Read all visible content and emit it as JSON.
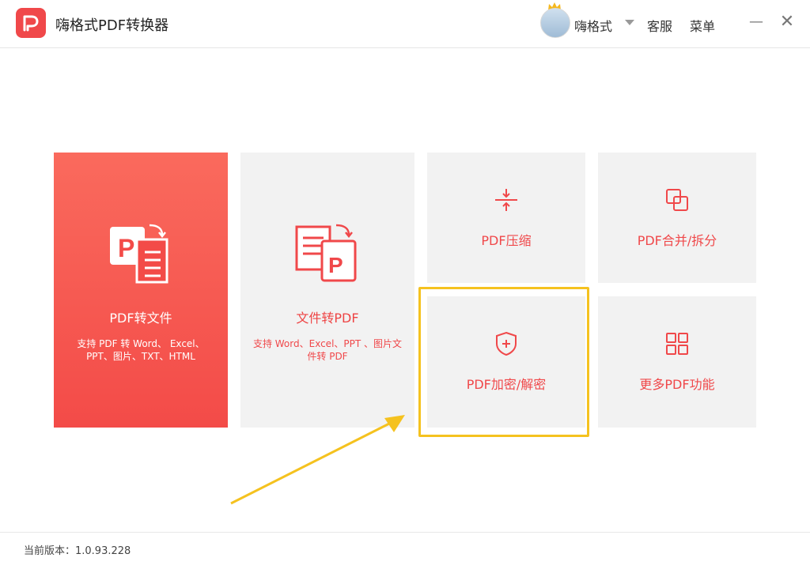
{
  "app": {
    "title": "嗨格式PDF转换器"
  },
  "header": {
    "username": "嗨格式",
    "service": "客服",
    "menu": "菜单",
    "minimize": "—",
    "close": "✕"
  },
  "tiles": {
    "pdf_to_file": {
      "title": "PDF转文件",
      "desc_line1": "支持 PDF 转 Word、 Excel、",
      "desc_line2": "PPT、图片、TXT、HTML"
    },
    "file_to_pdf": {
      "title": "文件转PDF",
      "desc_line1": "支持 Word、Excel、PPT 、图片文",
      "desc_line2": "件转 PDF"
    },
    "compress": {
      "title": "PDF压缩"
    },
    "merge_split": {
      "title": "PDF合并/拆分"
    },
    "encrypt": {
      "title": "PDF加密/解密"
    },
    "more": {
      "title": "更多PDF功能"
    }
  },
  "footer": {
    "version": "当前版本：1.0.93.228"
  },
  "colors": {
    "accent": "#f0484a",
    "highlight": "#f5c21f",
    "tile_bg": "#f2f2f2"
  }
}
